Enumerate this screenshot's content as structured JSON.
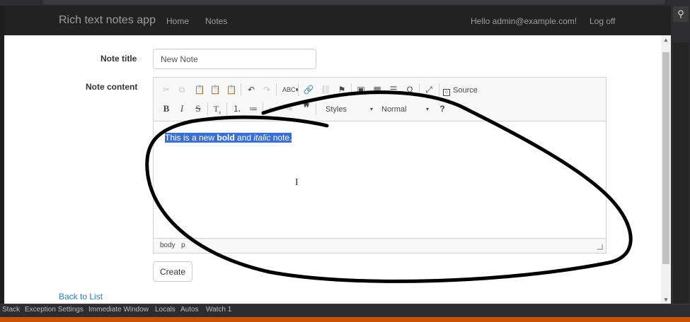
{
  "navbar": {
    "brand": "Rich text notes app",
    "links": [
      "Home",
      "Notes"
    ],
    "greeting": "Hello admin@example.com!",
    "logoff": "Log off"
  },
  "form": {
    "title_label": "Note title",
    "title_value": "New Note",
    "content_label": "Note content",
    "create_label": "Create",
    "back_label": "Back to List"
  },
  "editor": {
    "toolbar_row1": [
      "cut-icon",
      "copy-icon",
      "paste-icon",
      "paste-text-icon",
      "paste-word-icon",
      "undo-icon",
      "redo-icon",
      "spellcheck-icon",
      "link-icon",
      "unlink-icon",
      "anchor-icon",
      "image-icon",
      "table-icon",
      "horizontal-line-icon",
      "special-char-icon",
      "maximize-icon"
    ],
    "source_label": "Source",
    "styles_label": "Styles",
    "format_label": "Normal",
    "content": {
      "before": "This is a new ",
      "bold": "bold",
      "middle": " and ",
      "italic": "italic",
      "after": " note."
    },
    "path": [
      "body",
      "p"
    ]
  },
  "ide": {
    "bottom_tabs": [
      "Stack",
      "Exception Settings",
      "Immediate Window",
      "Locals",
      "Autos",
      "Watch 1"
    ],
    "accent_color": "#ca5100"
  },
  "annotation": {
    "color": "#000000"
  }
}
